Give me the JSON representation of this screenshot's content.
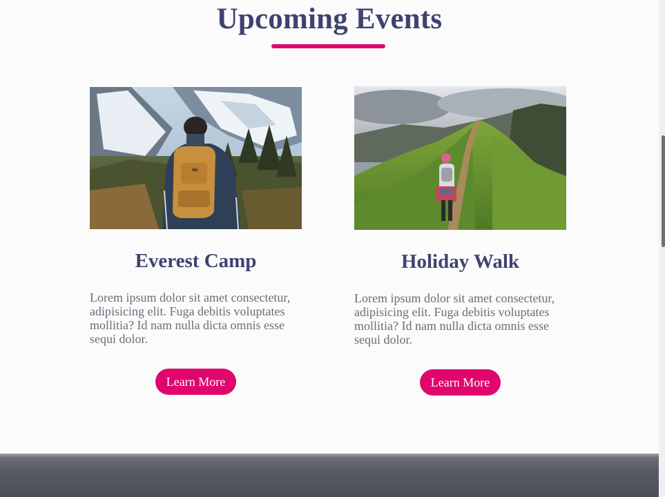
{
  "section": {
    "title": "Upcoming Events",
    "accent_color": "#e0076c"
  },
  "events": [
    {
      "title": "Everest Camp",
      "description": "Lorem ipsum dolor sit amet consectetur, adipisicing elit. Fuga debitis voluptates mollitia? Id nam nulla dicta omnis esse sequi dolor.",
      "button_label": "Learn More",
      "image_icon": "hiker-mountain-photo"
    },
    {
      "title": "Holiday Walk",
      "description": "Lorem ipsum dolor sit amet consectetur, adipisicing elit. Fuga debitis voluptates mollitia? Id nam nulla dicta omnis esse sequi dolor.",
      "button_label": "Learn More",
      "image_icon": "hill-trail-photo"
    }
  ],
  "colors": {
    "heading": "#3e4370",
    "body_text": "#6c6c7a",
    "button": "#e0076c",
    "background": "#fbfbfc"
  }
}
